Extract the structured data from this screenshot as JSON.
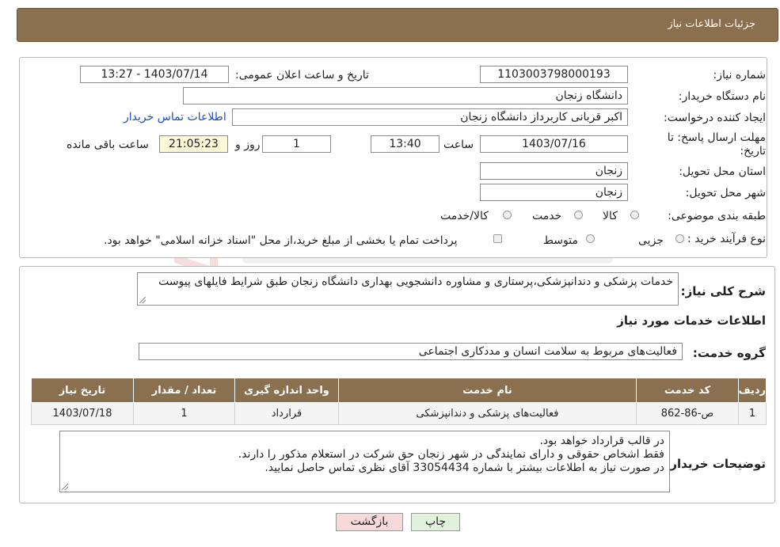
{
  "header": {
    "title": "جزئیات اطلاعات نیاز"
  },
  "form": {
    "need_number_label": "شماره نیاز:",
    "need_number": "1103003798000193",
    "announce_label": "تاریخ و ساعت اعلان عمومی:",
    "announce_value": "1403/07/14 - 13:27",
    "buyer_label": "نام دستگاه خریدار:",
    "buyer_value": "دانشگاه زنجان",
    "creator_label": "ایجاد کننده درخواست:",
    "creator_value": "اکبر قربانی کاربرداز دانشگاه زنجان",
    "contact_link": "اطلاعات تماس خریدار",
    "deadline_label": "مهلت ارسال پاسخ: تا تاریخ:",
    "deadline_date": "1403/07/16",
    "time_label": "ساعت",
    "deadline_time": "13:40",
    "days_value": "1",
    "days_label": "روز و",
    "remaining_value": "21:05:23",
    "remaining_label": "ساعت باقی مانده",
    "province_label": "استان محل تحویل:",
    "province_value": "زنجان",
    "city_label": "شهر محل تحویل:",
    "city_value": "زنجان",
    "category_label": "طبقه بندی موضوعی:",
    "category_options": [
      "کالا",
      "خدمت",
      "کالا/خدمت"
    ],
    "process_label": "نوع فرآیند خرید :",
    "process_options": [
      "جزیی",
      "متوسط"
    ],
    "payment_note": "پرداخت تمام یا بخشی از مبلغ خرید،از محل \"اسناد خزانه اسلامی\" خواهد بود."
  },
  "details": {
    "summary_label": "شرح کلی نیاز:",
    "summary_value": "خدمات پزشکی و دندانپزشکی،پرستاری و مشاوره دانشجویی بهداری دانشگاه زنجان طبق شرایط فایلهای پیوست",
    "services_title": "اطلاعات خدمات مورد نیاز",
    "group_label": "گروه خدمت:",
    "group_value": "فعالیت‌های مربوط به سلامت انسان و مددکاری اجتماعی"
  },
  "table": {
    "headers": [
      "ردیف",
      "کد خدمت",
      "نام خدمت",
      "واحد اندازه گیری",
      "تعداد / مقدار",
      "تاریخ نیاز"
    ],
    "rows": [
      [
        "1",
        "ص-86-862",
        "فعالیت‌های پزشکی و دندانپزشکی",
        "قرارداد",
        "1",
        "1403/07/18"
      ]
    ]
  },
  "notes": {
    "label": "توضیحات خریدار:",
    "lines": [
      "در قالب قرارداد خواهد بود.",
      "فقط اشخاص حقوقی و دارای نمایندگی در شهر زنجان حق شرکت در استعلام مذکور را دارند.",
      "در صورت نیاز به اطلاعات بیشتر با شماره 33054434 آقای نظری تماس حاصل نمایید."
    ]
  },
  "buttons": {
    "print": "چاپ",
    "back": "بازگشت"
  },
  "colors": {
    "header_bg": "#8B7050",
    "back_btn": "#f7d9d9",
    "print_btn": "#e0f2dc",
    "link": "#1a4fbd"
  }
}
